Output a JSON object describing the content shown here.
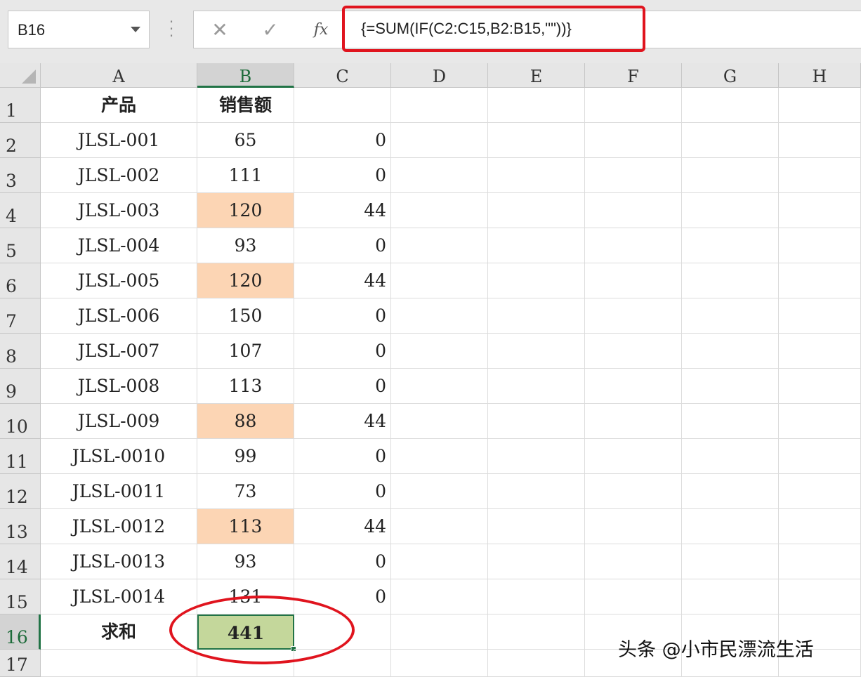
{
  "formula_bar": {
    "name_box": "B16",
    "cancel_symbol": "✕",
    "enter_symbol": "✓",
    "fx_label": "fx",
    "formula": "{=SUM(IF(C2:C15,B2:B15,\"\"))}"
  },
  "columns": [
    "A",
    "B",
    "C",
    "D",
    "E",
    "F",
    "G",
    "H"
  ],
  "selected_column": "B",
  "rows": [
    {
      "num": "1",
      "a": "产品",
      "b": "销售额",
      "c": "",
      "header": true
    },
    {
      "num": "2",
      "a": "JLSL-001",
      "b": "65",
      "c": "0"
    },
    {
      "num": "3",
      "a": "JLSL-002",
      "b": "111",
      "c": "0"
    },
    {
      "num": "4",
      "a": "JLSL-003",
      "b": "120",
      "c": "44",
      "hl": true
    },
    {
      "num": "5",
      "a": "JLSL-004",
      "b": "93",
      "c": "0"
    },
    {
      "num": "6",
      "a": "JLSL-005",
      "b": "120",
      "c": "44",
      "hl": true
    },
    {
      "num": "7",
      "a": "JLSL-006",
      "b": "150",
      "c": "0"
    },
    {
      "num": "8",
      "a": "JLSL-007",
      "b": "107",
      "c": "0"
    },
    {
      "num": "9",
      "a": "JLSL-008",
      "b": "113",
      "c": "0"
    },
    {
      "num": "10",
      "a": "JLSL-009",
      "b": "88",
      "c": "44",
      "hl": true
    },
    {
      "num": "11",
      "a": "JLSL-0010",
      "b": "99",
      "c": "0"
    },
    {
      "num": "12",
      "a": "JLSL-0011",
      "b": "73",
      "c": "0"
    },
    {
      "num": "13",
      "a": "JLSL-0012",
      "b": "113",
      "c": "44",
      "hl": true
    },
    {
      "num": "14",
      "a": "JLSL-0013",
      "b": "93",
      "c": "0"
    },
    {
      "num": "15",
      "a": "JLSL-0014",
      "b": "131",
      "c": "0"
    },
    {
      "num": "16",
      "a": "求和",
      "b": "441",
      "c": "",
      "total": true
    },
    {
      "num": "17",
      "a": "",
      "b": "",
      "c": ""
    }
  ],
  "colors": {
    "highlight_fill": "#fcd5b4",
    "active_fill": "#c4d79b",
    "excel_green": "#217346",
    "annotation_red": "#e0141e"
  },
  "watermark": "头条 @小市民漂流生活"
}
